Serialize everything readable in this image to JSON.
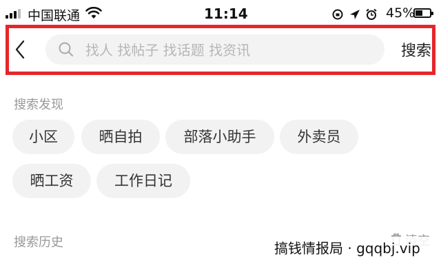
{
  "status_bar": {
    "carrier": "中国联通",
    "time": "11:14",
    "battery": "45%",
    "icons": [
      "signal-icon",
      "wifi-icon",
      "orientation-lock-icon",
      "location-icon",
      "alarm-icon",
      "battery-icon"
    ]
  },
  "header": {
    "back_icon": "chevron-left-icon",
    "search_placeholder": "找人 找帖子 找话题 找资讯",
    "search_value": "",
    "search_button": "搜索",
    "highlight_color": "#e5262b"
  },
  "discover": {
    "title": "搜索发现",
    "tags": [
      "小区",
      "晒自拍",
      "部落小助手",
      "外卖员",
      "晒工资",
      "工作日记"
    ]
  },
  "history": {
    "title": "搜索历史",
    "clear_label": "清空",
    "clear_icon": "trash-icon"
  },
  "watermark": "搞钱情报局 · gqqbj.vip"
}
